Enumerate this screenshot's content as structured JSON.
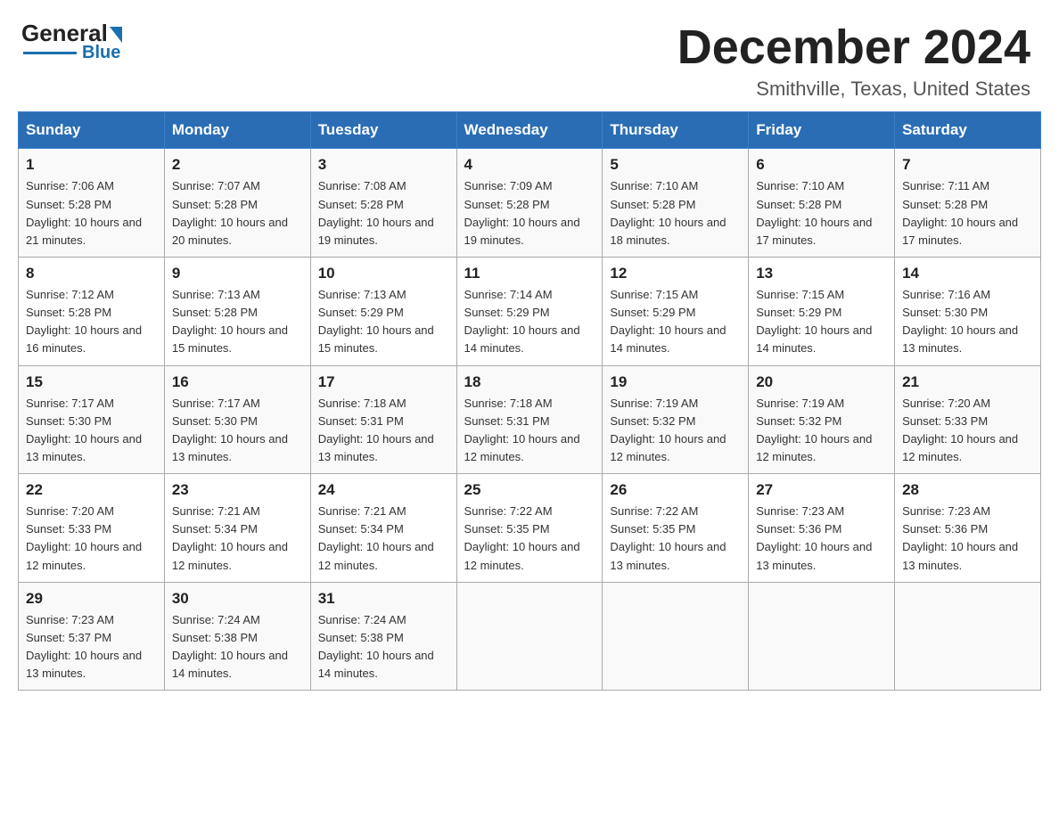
{
  "logo": {
    "general": "General",
    "arrow": "",
    "blue": "Blue"
  },
  "header": {
    "month": "December 2024",
    "location": "Smithville, Texas, United States"
  },
  "days_of_week": [
    "Sunday",
    "Monday",
    "Tuesday",
    "Wednesday",
    "Thursday",
    "Friday",
    "Saturday"
  ],
  "weeks": [
    [
      {
        "day": "1",
        "sunrise": "7:06 AM",
        "sunset": "5:28 PM",
        "daylight": "10 hours and 21 minutes."
      },
      {
        "day": "2",
        "sunrise": "7:07 AM",
        "sunset": "5:28 PM",
        "daylight": "10 hours and 20 minutes."
      },
      {
        "day": "3",
        "sunrise": "7:08 AM",
        "sunset": "5:28 PM",
        "daylight": "10 hours and 19 minutes."
      },
      {
        "day": "4",
        "sunrise": "7:09 AM",
        "sunset": "5:28 PM",
        "daylight": "10 hours and 19 minutes."
      },
      {
        "day": "5",
        "sunrise": "7:10 AM",
        "sunset": "5:28 PM",
        "daylight": "10 hours and 18 minutes."
      },
      {
        "day": "6",
        "sunrise": "7:10 AM",
        "sunset": "5:28 PM",
        "daylight": "10 hours and 17 minutes."
      },
      {
        "day": "7",
        "sunrise": "7:11 AM",
        "sunset": "5:28 PM",
        "daylight": "10 hours and 17 minutes."
      }
    ],
    [
      {
        "day": "8",
        "sunrise": "7:12 AM",
        "sunset": "5:28 PM",
        "daylight": "10 hours and 16 minutes."
      },
      {
        "day": "9",
        "sunrise": "7:13 AM",
        "sunset": "5:28 PM",
        "daylight": "10 hours and 15 minutes."
      },
      {
        "day": "10",
        "sunrise": "7:13 AM",
        "sunset": "5:29 PM",
        "daylight": "10 hours and 15 minutes."
      },
      {
        "day": "11",
        "sunrise": "7:14 AM",
        "sunset": "5:29 PM",
        "daylight": "10 hours and 14 minutes."
      },
      {
        "day": "12",
        "sunrise": "7:15 AM",
        "sunset": "5:29 PM",
        "daylight": "10 hours and 14 minutes."
      },
      {
        "day": "13",
        "sunrise": "7:15 AM",
        "sunset": "5:29 PM",
        "daylight": "10 hours and 14 minutes."
      },
      {
        "day": "14",
        "sunrise": "7:16 AM",
        "sunset": "5:30 PM",
        "daylight": "10 hours and 13 minutes."
      }
    ],
    [
      {
        "day": "15",
        "sunrise": "7:17 AM",
        "sunset": "5:30 PM",
        "daylight": "10 hours and 13 minutes."
      },
      {
        "day": "16",
        "sunrise": "7:17 AM",
        "sunset": "5:30 PM",
        "daylight": "10 hours and 13 minutes."
      },
      {
        "day": "17",
        "sunrise": "7:18 AM",
        "sunset": "5:31 PM",
        "daylight": "10 hours and 13 minutes."
      },
      {
        "day": "18",
        "sunrise": "7:18 AM",
        "sunset": "5:31 PM",
        "daylight": "10 hours and 12 minutes."
      },
      {
        "day": "19",
        "sunrise": "7:19 AM",
        "sunset": "5:32 PM",
        "daylight": "10 hours and 12 minutes."
      },
      {
        "day": "20",
        "sunrise": "7:19 AM",
        "sunset": "5:32 PM",
        "daylight": "10 hours and 12 minutes."
      },
      {
        "day": "21",
        "sunrise": "7:20 AM",
        "sunset": "5:33 PM",
        "daylight": "10 hours and 12 minutes."
      }
    ],
    [
      {
        "day": "22",
        "sunrise": "7:20 AM",
        "sunset": "5:33 PM",
        "daylight": "10 hours and 12 minutes."
      },
      {
        "day": "23",
        "sunrise": "7:21 AM",
        "sunset": "5:34 PM",
        "daylight": "10 hours and 12 minutes."
      },
      {
        "day": "24",
        "sunrise": "7:21 AM",
        "sunset": "5:34 PM",
        "daylight": "10 hours and 12 minutes."
      },
      {
        "day": "25",
        "sunrise": "7:22 AM",
        "sunset": "5:35 PM",
        "daylight": "10 hours and 12 minutes."
      },
      {
        "day": "26",
        "sunrise": "7:22 AM",
        "sunset": "5:35 PM",
        "daylight": "10 hours and 13 minutes."
      },
      {
        "day": "27",
        "sunrise": "7:23 AM",
        "sunset": "5:36 PM",
        "daylight": "10 hours and 13 minutes."
      },
      {
        "day": "28",
        "sunrise": "7:23 AM",
        "sunset": "5:36 PM",
        "daylight": "10 hours and 13 minutes."
      }
    ],
    [
      {
        "day": "29",
        "sunrise": "7:23 AM",
        "sunset": "5:37 PM",
        "daylight": "10 hours and 13 minutes."
      },
      {
        "day": "30",
        "sunrise": "7:24 AM",
        "sunset": "5:38 PM",
        "daylight": "10 hours and 14 minutes."
      },
      {
        "day": "31",
        "sunrise": "7:24 AM",
        "sunset": "5:38 PM",
        "daylight": "10 hours and 14 minutes."
      },
      null,
      null,
      null,
      null
    ]
  ]
}
